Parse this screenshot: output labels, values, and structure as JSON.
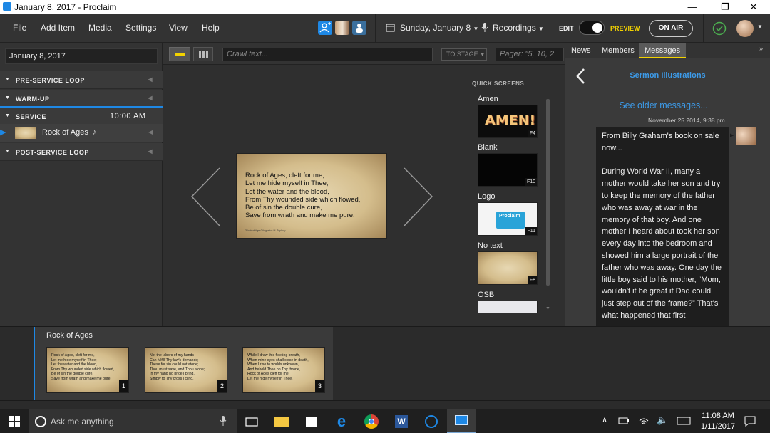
{
  "window": {
    "title": "January 8, 2017 - Proclaim"
  },
  "menu": {
    "items": [
      "File",
      "Add Item",
      "Media",
      "Settings",
      "View",
      "Help"
    ]
  },
  "header": {
    "date_label": "Sunday, January 8",
    "recordings_label": "Recordings",
    "edit_label": "EDIT",
    "preview_label": "PREVIEW",
    "on_air_label": "ON AIR"
  },
  "left": {
    "date_value": "January 8, 2017",
    "sections": [
      {
        "label": "PRE-SERVICE LOOP",
        "time": ""
      },
      {
        "label": "WARM-UP",
        "time": ""
      },
      {
        "label": "SERVICE",
        "time": "10:00 AM"
      },
      {
        "label": "POST-SERVICE LOOP",
        "time": ""
      }
    ],
    "service_item": {
      "label": "Rock of Ages"
    }
  },
  "toolbar": {
    "crawl_placeholder": "Crawl text...",
    "to_stage_label": "TO STAGE",
    "pager_placeholder": "Pager: \"5, 10, 2"
  },
  "stage": {
    "slide_lines": [
      "Rock of Ages, cleft for me,",
      "Let me hide myself in Thee;",
      "Let the water and the blood,",
      "From Thy wounded side which flowed,",
      "Be of sin the double cure,",
      "Save from wrath and make me pure."
    ],
    "slide_caption": "\"Rock of Ages\" Augustus M. Toplady"
  },
  "quick_screens": {
    "title": "QUICK SCREENS",
    "items": [
      {
        "label": "Amen",
        "key": "F4",
        "art": "AMEN!"
      },
      {
        "label": "Blank",
        "key": "F10"
      },
      {
        "label": "Logo",
        "key": "F11",
        "art": "Proclaim"
      },
      {
        "label": "No text",
        "key": "F8"
      },
      {
        "label": "OSB",
        "key": ""
      }
    ]
  },
  "right": {
    "tabs": [
      "News",
      "Members",
      "Messages"
    ],
    "active_tab": "Messages",
    "topic": "Sermon Illustrations",
    "older_link": "See older messages...",
    "timestamp": "November 25 2014, 9:38 pm",
    "message_p1": "From Billy Graham's book on sale now...",
    "message_p2": "During World War II, many a mother would take her son and try to keep the memory of the father who was away at war in the memory of that boy. And one mother I heard about took her son every day into the bedroom and showed him a large portrait of the father who was away. One day the little boy said to his mother, “Mom, wouldn't it be great if Dad could just step out of the frame?” That's what happened that first"
  },
  "bottom": {
    "item_title": "Rock of Ages",
    "slides": [
      {
        "num": "1",
        "lines": [
          "Rock of Ages, cleft for me,",
          "Let me hide myself in Thee;",
          "Let the water and the blood,",
          "From Thy wounded side which flowed,",
          "Be of sin the double cure,",
          "Save from wrath and make me pure."
        ]
      },
      {
        "num": "2",
        "lines": [
          "Not the labors of my hands",
          "Can fulfill Thy law's demands;",
          "These for sin could not atone;",
          "Thou must save, and Thou alone;",
          "In my hand no price I bring,",
          "Simply to Thy cross I cling."
        ]
      },
      {
        "num": "3",
        "lines": [
          "While I draw this fleeting breath,",
          "When mine eyes shall close in death,",
          "When I rise to worlds unknown,",
          "And behold Thee on Thy throne,",
          "Rock of Ages cleft for me,",
          "Let me hide myself in Thee."
        ]
      }
    ]
  },
  "taskbar": {
    "search_placeholder": "Ask me anything",
    "time": "11:08 AM",
    "date": "1/11/2017"
  },
  "colors": {
    "accent": "#1e88e5",
    "preview": "#f2d200",
    "link": "#3d9be9"
  }
}
